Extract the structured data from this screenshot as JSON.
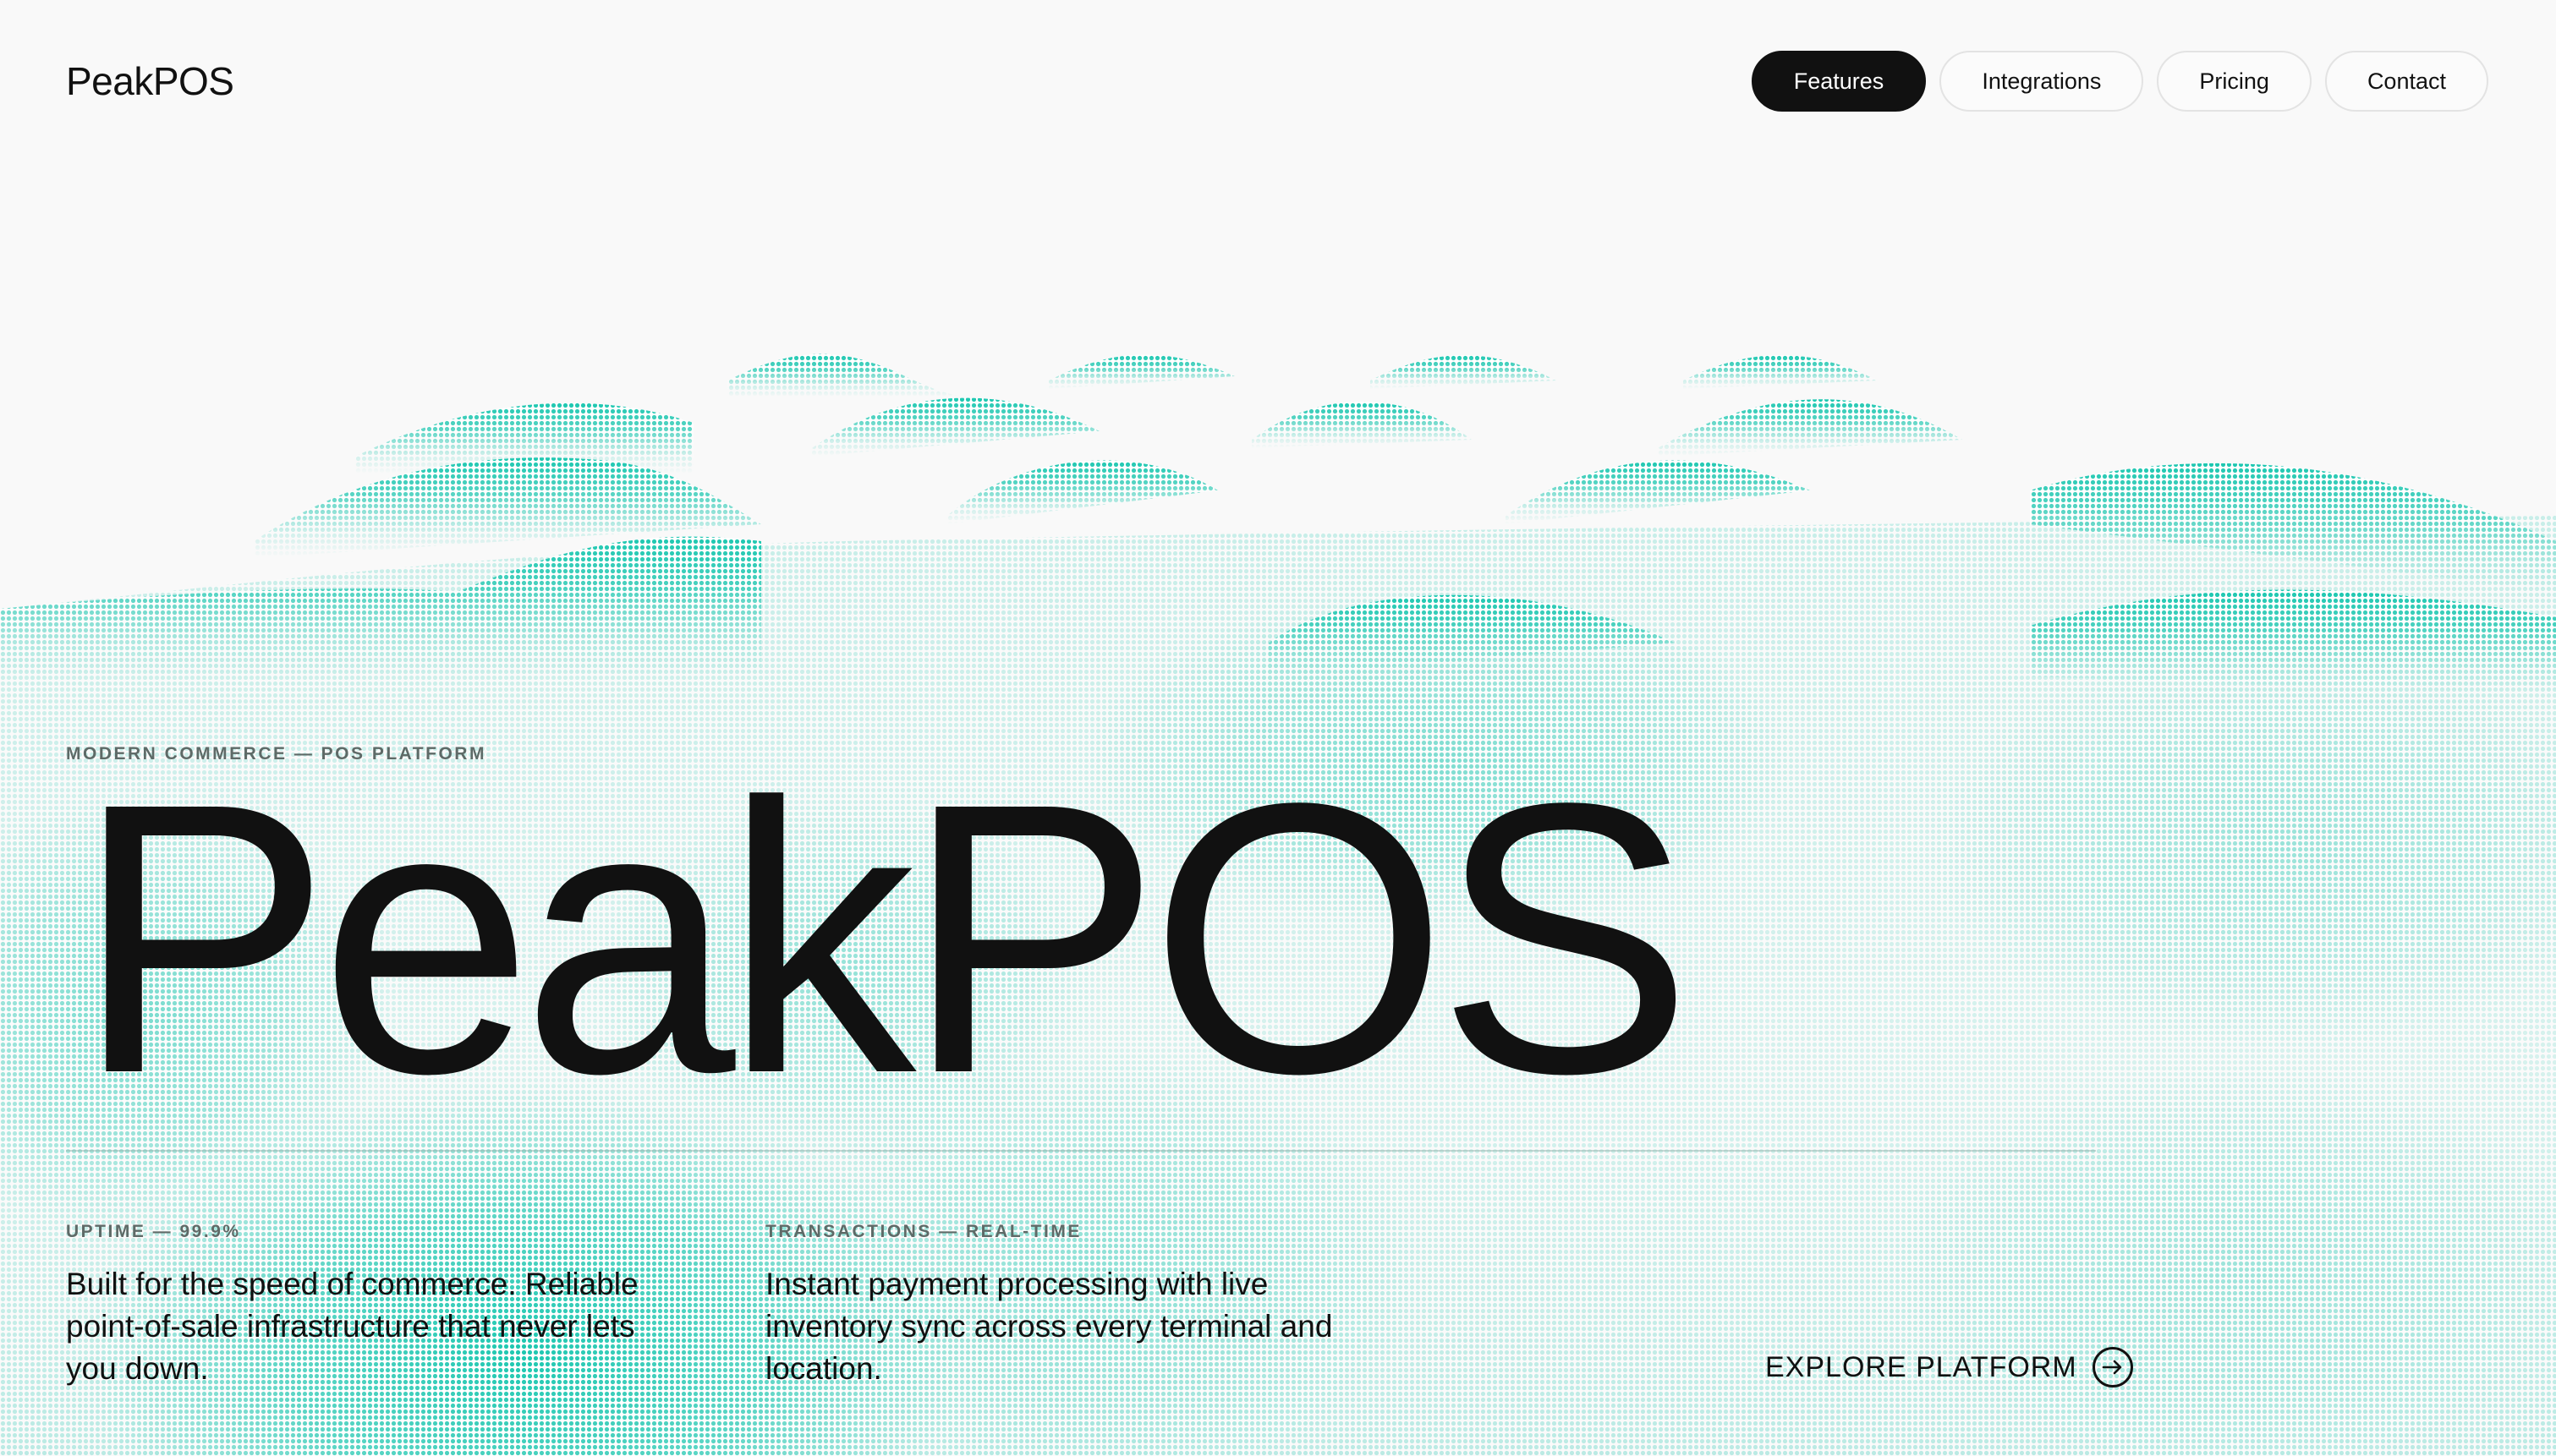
{
  "brand": {
    "logo_text": "PeakPOS",
    "accent_color": "#1cc7b0",
    "background_color": "#f9f9f9",
    "text_color": "#111111"
  },
  "nav": {
    "items": [
      {
        "label": "Features",
        "active": true
      },
      {
        "label": "Integrations",
        "active": false
      },
      {
        "label": "Pricing",
        "active": false
      },
      {
        "label": "Contact",
        "active": false
      }
    ]
  },
  "hero": {
    "eyebrow": "MODERN COMMERCE — POS PLATFORM",
    "title": "PeakPOS"
  },
  "stats": [
    {
      "label": "UPTIME — 99.9%",
      "text": "Built for the speed of commerce. Reliable point-of-sale infrastructure that never lets you down."
    },
    {
      "label": "TRANSACTIONS — REAL-TIME",
      "text": "Instant payment processing with live inventory sync across every terminal and location."
    }
  ],
  "cta": {
    "label": "EXPLORE PLATFORM",
    "icon": "arrow-right-circle-icon"
  },
  "background": {
    "graphic": "teal-dotted-terrain-peaks"
  }
}
